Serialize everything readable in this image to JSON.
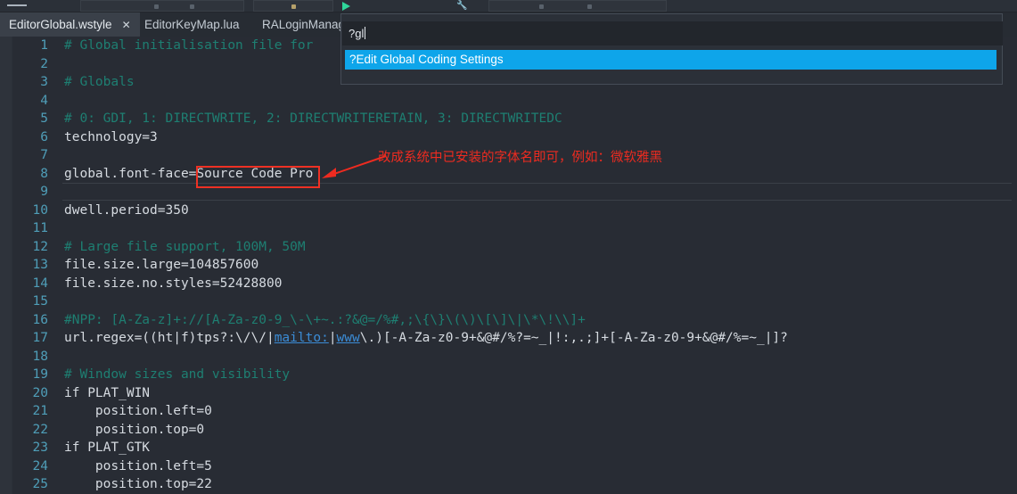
{
  "toolbar": {
    "menu_icon": "hamburger-icon",
    "run_icon": "play-icon",
    "tools_icon": "wrench-icon"
  },
  "tabs": [
    {
      "label": "EditorGlobal.wstyle",
      "active": true,
      "close_label": "✕"
    },
    {
      "label": "EditorKeyMap.lua",
      "active": false
    },
    {
      "label": "RALoginManag",
      "active": false
    }
  ],
  "palette": {
    "query": "?gl",
    "results": [
      {
        "label": "?Edit Global Coding Settings",
        "selected": true
      }
    ]
  },
  "editor": {
    "lines": [
      {
        "n": "1",
        "text": "# Global initialisation file for ",
        "style": "comment"
      },
      {
        "n": "2",
        "text": "",
        "style": "plain"
      },
      {
        "n": "3",
        "text": "# Globals",
        "style": "comment"
      },
      {
        "n": "4",
        "text": "",
        "style": "plain"
      },
      {
        "n": "5",
        "text": "# 0: GDI, 1: DIRECTWRITE, 2: DIRECTWRITERETAIN, 3: DIRECTWRITEDC",
        "style": "comment"
      },
      {
        "n": "6",
        "text": "technology=3",
        "style": "plain"
      },
      {
        "n": "7",
        "text": "",
        "style": "plain"
      },
      {
        "n": "8",
        "text": "global.font-face=Source Code Pro",
        "style": "plain"
      },
      {
        "n": "9",
        "text": "",
        "style": "plain",
        "current": true
      },
      {
        "n": "10",
        "text": "dwell.period=350",
        "style": "plain"
      },
      {
        "n": "11",
        "text": "",
        "style": "plain"
      },
      {
        "n": "12",
        "text": "# Large file support, 100M, 50M",
        "style": "comment"
      },
      {
        "n": "13",
        "text": "file.size.large=104857600",
        "style": "plain"
      },
      {
        "n": "14",
        "text": "file.size.no.styles=52428800",
        "style": "plain"
      },
      {
        "n": "15",
        "text": "",
        "style": "plain"
      },
      {
        "n": "16",
        "text": "#NPP: [A-Za-z]+://[A-Za-z0-9_\\-\\+~.:?&@=/%#,;\\{\\}\\(\\)\\[\\]\\|\\*\\!\\\\]+",
        "style": "comment"
      },
      {
        "n": "17",
        "text": "url.regex=((ht|f)tps?:\\/\\/|mailto:|www\\.)[-A-Za-z0-9+&@#/%?=~_|!:,.;]+[-A-Za-z0-9+&@#/%=~_|]?",
        "style": "url"
      },
      {
        "n": "18",
        "text": "",
        "style": "plain"
      },
      {
        "n": "19",
        "text": "# Window sizes and visibility",
        "style": "comment"
      },
      {
        "n": "20",
        "text": "if PLAT_WIN",
        "style": "plain"
      },
      {
        "n": "21",
        "text": "    position.left=0",
        "style": "plain"
      },
      {
        "n": "22",
        "text": "    position.top=0",
        "style": "plain"
      },
      {
        "n": "23",
        "text": "if PLAT_GTK",
        "style": "plain"
      },
      {
        "n": "24",
        "text": "    position.left=5",
        "style": "plain"
      },
      {
        "n": "25",
        "text": "    position.top=22",
        "style": "plain"
      }
    ],
    "url_line_parts": {
      "pre": "url.regex=((ht|f)tps?:\\/\\/|",
      "link1": "mailto:",
      "mid": "|",
      "link2": "www",
      "post": "\\.)[-A-Za-z0-9+&@#/%?=~_|!:,.;]+[-A-Za-z0-9+&@#/%=~_|]?"
    }
  },
  "annotation": {
    "text": "改成系统中已安装的字体名即可，例如：微软雅黑",
    "highlight_target": "Source Code Pro",
    "color": "#ee2b20"
  },
  "colors": {
    "editor_bg": "#282c34",
    "comment": "#1e7f72",
    "line_number": "#4f9eb8",
    "code_text": "#d6dbe1",
    "accent_blue": "#0ea5ea",
    "link": "#3b8cd6",
    "annotation_red": "#ee3124"
  }
}
